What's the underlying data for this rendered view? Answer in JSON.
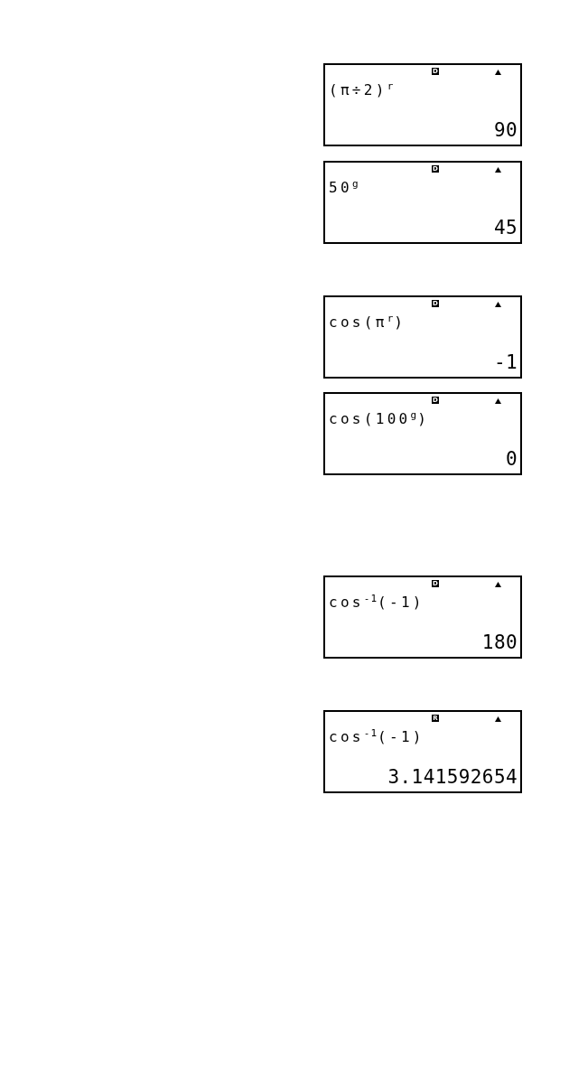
{
  "screens": [
    {
      "indicator": "D",
      "expression": "(π÷2)$^{r}$",
      "result": "90"
    },
    {
      "indicator": "D",
      "expression": "50$^{g}$",
      "result": "45"
    },
    {
      "indicator": "D",
      "expression": "cos(π$^{r}$)",
      "result": "-1"
    },
    {
      "indicator": "D",
      "expression": "cos(100$^{g}$)",
      "result": "0"
    },
    {
      "indicator": "D",
      "expression": "cos$^{-1}$(-1)",
      "result": "180"
    },
    {
      "indicator": "R",
      "expression": "cos$^{-1}$(-1)",
      "result": "3.141592654"
    }
  ]
}
